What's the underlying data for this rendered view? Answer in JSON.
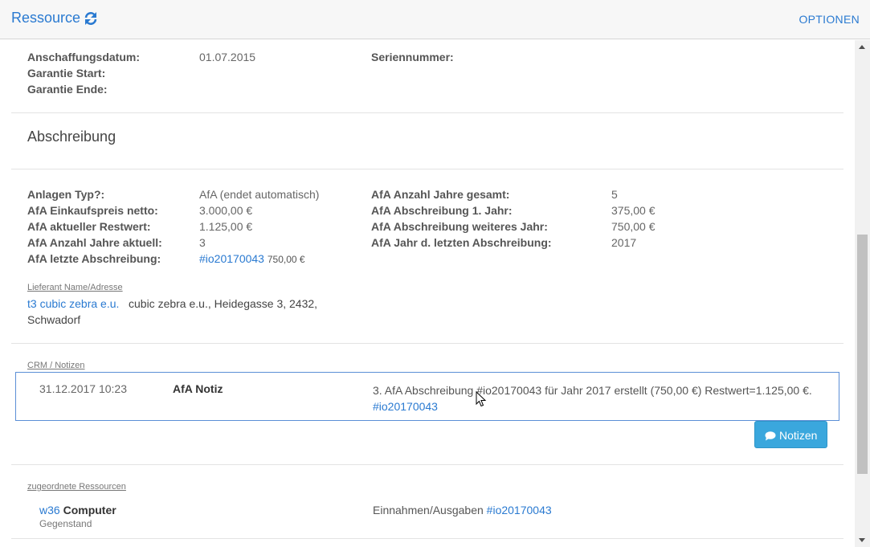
{
  "header": {
    "title": "Ressource",
    "refresh_icon": "refresh-icon",
    "options_label": "OPTIONEN"
  },
  "purchase": {
    "acquisition_date_label": "Anschaffungsdatum:",
    "acquisition_date_value": "01.07.2015",
    "warranty_start_label": "Garantie Start:",
    "warranty_end_label": "Garantie Ende:",
    "serial_label": "Seriennummer:"
  },
  "depreciation": {
    "section_title": "Abschreibung",
    "left": [
      {
        "label": "Anlagen Typ?:",
        "value": "AfA (endet automatisch)"
      },
      {
        "label": "AfA Einkaufspreis netto:",
        "value": "3.000,00 €"
      },
      {
        "label": "AfA aktueller Restwert:",
        "value": "1.125,00 €"
      },
      {
        "label": "AfA Anzahl Jahre aktuell:",
        "value": "3"
      },
      {
        "label": "AfA letzte Abschreibung:",
        "value_link": "#io20170043",
        "value_suffix": "750,00 €"
      }
    ],
    "right": [
      {
        "label": "AfA Anzahl Jahre gesamt:",
        "value": "5"
      },
      {
        "label": "AfA Abschreibung 1. Jahr:",
        "value": "375,00 €"
      },
      {
        "label": "AfA Abschreibung weiteres Jahr:",
        "value": "750,00 €"
      },
      {
        "label": "AfA Jahr d. letzten Abschreibung:",
        "value": "2017"
      }
    ]
  },
  "supplier": {
    "label": "Lieferant Name/Adresse",
    "link": "t3 cubic zebra e.u.",
    "address_line1": "cubic zebra e.u., Heidegasse 3, 2432,",
    "address_line2": "Schwadorf"
  },
  "crm": {
    "label": "CRM / Notizen",
    "note": {
      "date": "31.12.2017 10:23",
      "title": "AfA Notiz",
      "text": "3. AfA Abschreibung #io20170043 für Jahr 2017 erstellt (750,00 €) Restwert=1.125,00 €.",
      "link": "#io20170043"
    },
    "notes_button": "Notizen"
  },
  "assigned": {
    "label": "zugeordnete Ressourcen",
    "item_link": "w36",
    "item_name": "Computer",
    "item_type": "Gegenstand",
    "item_category": "Einnahmen/Ausgaben",
    "item_ref_link": "#io20170043"
  },
  "colors": {
    "accent": "#2a7ad1",
    "button": "#3aa7dd",
    "note_border": "#5b8fd6"
  }
}
